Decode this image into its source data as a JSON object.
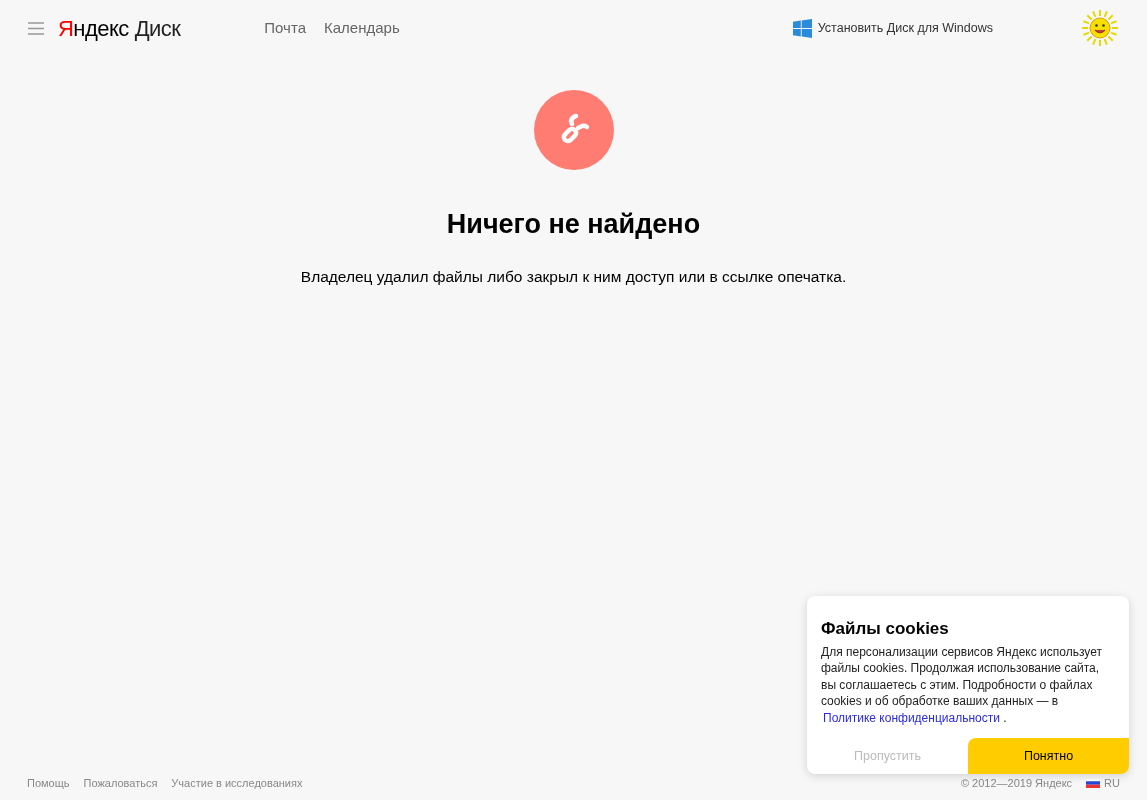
{
  "header": {
    "logo": {
      "first_letter": "Я",
      "rest": "ндекс",
      "product": "Диск"
    },
    "nav": [
      {
        "label": "Почта"
      },
      {
        "label": "Календарь"
      }
    ],
    "install_link": "Установить Диск для Windows"
  },
  "message": {
    "title": "Ничего не найдено",
    "text": "Владелец удалил файлы либо закрыл к ним доступ или в ссылке опечатка."
  },
  "footer": {
    "links": [
      "Помощь",
      "Пожаловаться",
      "Участие в исследованиях"
    ],
    "copyright": "© 2012—2019 Яндекс",
    "language": "RU"
  },
  "cookie_popup": {
    "title": "Файлы cookies",
    "text": "Для персонализации сервисов Яндекс использует файлы cookies. Продолжая использование сайта, вы соглашаетесь с этим. Подробности о файлах cookies и об обработке ваших данных — в",
    "link": "Политике конфиденциальности",
    "after_link": ".",
    "skip_button": "Пропустить",
    "accept_button": "Понятно"
  }
}
